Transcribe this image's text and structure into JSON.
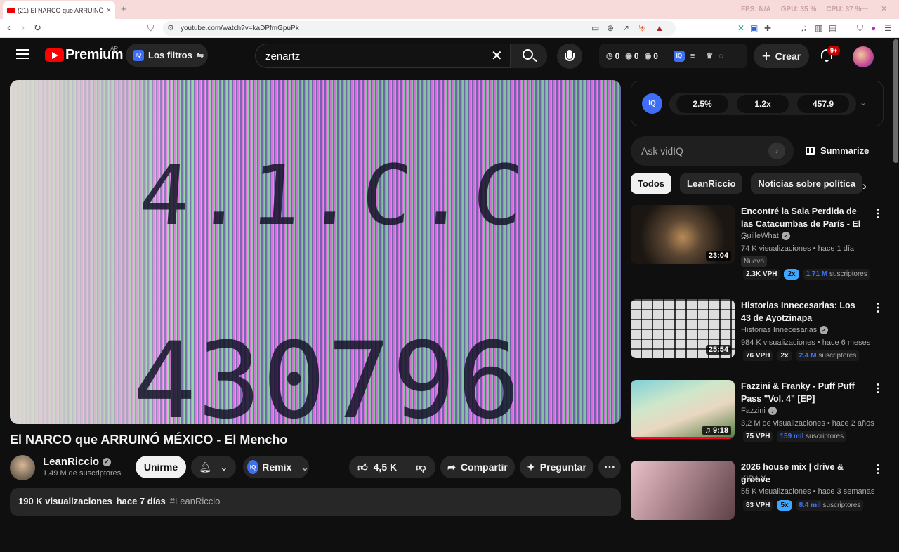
{
  "browser": {
    "tab_title": "(21) El NARCO que ARRUINÓ",
    "tab_close": "×",
    "new_tab": "+",
    "stats": [
      "FPS: N/A",
      "GPU: 35 %",
      "CPU: 37 %"
    ],
    "url": "youtube.com/watch?v=kaDPfmGpuPk"
  },
  "header": {
    "brand": "Premium",
    "country": "AR",
    "filters_label": "Los filtros",
    "search_value": "zenartz",
    "counters": [
      {
        "icon": "clock-icon",
        "value": "0"
      },
      {
        "icon": "eye-icon",
        "value": "0"
      },
      {
        "icon": "eye-icon",
        "value": "0"
      },
      {
        "icon": "vidiq-icon",
        "value": "0"
      }
    ],
    "create_label": "Crear",
    "notifications_badge": "9+"
  },
  "video": {
    "overlay_line1": "4.1.C.C",
    "overlay_line2": "430796",
    "title": "El NARCO que ARRUINÓ MÉXICO - El Mencho",
    "channel": "LeanRiccio",
    "subscribers": "1,49 M de suscriptores",
    "join_label": "Unirme",
    "remix_label": "Remix",
    "likes": "4,5 K",
    "share_label": "Compartir",
    "ask_label": "Preguntar",
    "views": "190 K visualizaciones",
    "date": "hace 7 días",
    "hashtag": "#LeanRiccio"
  },
  "vidiq": {
    "logo": "IQ",
    "stats": [
      "2.5%",
      "1.2x",
      "457.9"
    ],
    "ask_placeholder": "Ask vidIQ",
    "summarize_label": "Summarize"
  },
  "chips": [
    "Todos",
    "LeanRiccio",
    "Noticias sobre política"
  ],
  "recommendations": [
    {
      "title": "Encontré la Sala Perdida de las Catacumbas de París - El ...",
      "channel": "GuilleWhat",
      "meta": "74 K visualizaciones • hace 1 día",
      "badge": "Nuevo",
      "duration": "23:04",
      "vph": "2.3K VPH",
      "mult": "2x",
      "subs_num": "1.71 M",
      "subs_label": "suscriptores"
    },
    {
      "title": "Historias Innecesarias: Los 43 de Ayotzinapa",
      "channel": "Historias Innecesarias",
      "meta": "984 K visualizaciones • hace 6 meses",
      "duration": "25:54",
      "vph": "76 VPH",
      "mult": "2x",
      "subs_num": "2.4 M",
      "subs_label": "suscriptores"
    },
    {
      "title": "Fazzini & Franky - Puff Puff Pass \"Vol. 4\" [EP]",
      "channel": "Fazzini",
      "meta": "3,2 M de visualizaciones • hace 2 años",
      "duration": "9:18",
      "vph": "75 VPH",
      "subs_num": "159 mil",
      "subs_label": "suscriptores",
      "progress": 1.0
    },
    {
      "title": "2026 house mix | drive & groove",
      "channel": "KIRA X",
      "meta": "55 K visualizaciones • hace 3 semanas",
      "vph": "83 VPH",
      "mult": "5x",
      "subs_num": "8.4 mil",
      "subs_label": "suscriptores"
    }
  ],
  "colors": {
    "accent": "#3ea6ff",
    "brand_red": "#ff0000",
    "background": "#0f0f0f"
  }
}
